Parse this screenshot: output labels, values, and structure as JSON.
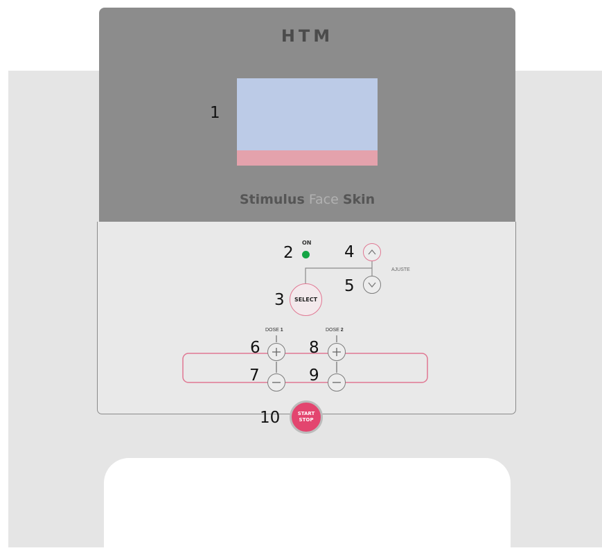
{
  "device": {
    "brand": "HTM",
    "product_name": {
      "part1": "Stimulus",
      "part2": "Face",
      "part3": "Skin"
    }
  },
  "labels": {
    "on": "ON",
    "ajuste": "AJUSTE",
    "dose1_prefix": "DOSE",
    "dose1_num": "1",
    "dose2_prefix": "DOSE",
    "dose2_num": "2"
  },
  "buttons": {
    "select": "SELECT",
    "start": "START",
    "stop": "STOP"
  },
  "callouts": {
    "n1": "1",
    "n2": "2",
    "n3": "3",
    "n4": "4",
    "n5": "5",
    "n6": "6",
    "n7": "7",
    "n8": "8",
    "n9": "9",
    "n10": "10"
  },
  "colors": {
    "panel_top": "#8c8c8c",
    "screen": "#bccbe7",
    "screen_strip": "#e4a2ac",
    "led_on": "#14a544",
    "start_button": "#e3456f",
    "dose_frame": "#e07792"
  },
  "icons": {
    "up": "chevron-up-icon",
    "down": "chevron-down-icon",
    "plus": "plus-icon",
    "minus": "minus-icon"
  }
}
